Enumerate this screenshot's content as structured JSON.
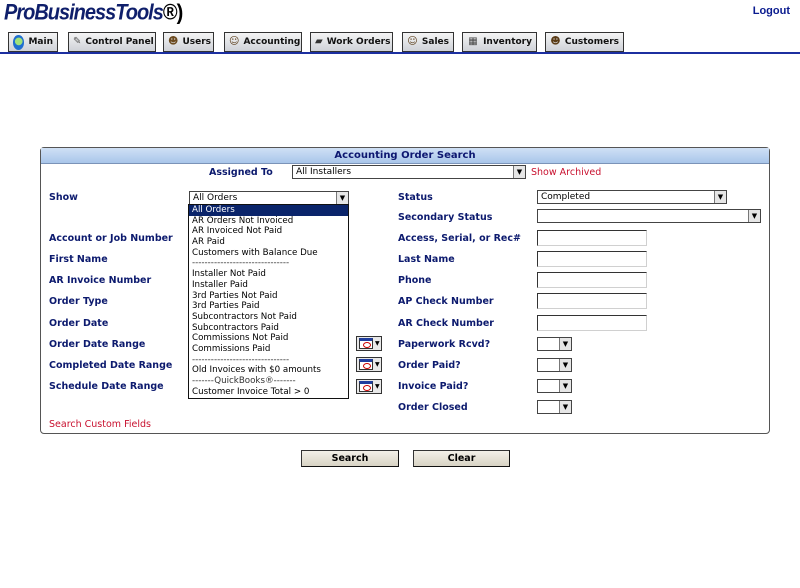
{
  "app": {
    "logo": "ProBusinessTools",
    "logo_suffix": "®)",
    "logout_label": "Logout"
  },
  "tabs": [
    {
      "label": "Main",
      "icon": "globe-icon"
    },
    {
      "label": "Control Panel",
      "icon": "tools-icon"
    },
    {
      "label": "Users",
      "icon": "users-icon"
    },
    {
      "label": "Accounting",
      "icon": "accountant-icon"
    },
    {
      "label": "Work Orders",
      "icon": "truck-icon"
    },
    {
      "label": "Sales",
      "icon": "salesperson-icon"
    },
    {
      "label": "Inventory",
      "icon": "inventory-icon"
    },
    {
      "label": "Customers",
      "icon": "customers-icon"
    }
  ],
  "panel": {
    "title": "Accounting Order Search",
    "assigned_to_label": "Assigned To",
    "assigned_to_value": "All Installers",
    "show_archived": "Show Archived",
    "left_labels": {
      "show": "Show",
      "account": "Account or Job Number",
      "first_name": "First Name",
      "ar_invoice": "AR Invoice Number",
      "order_type": "Order Type",
      "order_date": "Order Date",
      "order_date_range": "Order Date Range",
      "completed_date_range": "Completed Date Range",
      "schedule_date_range": "Schedule Date Range"
    },
    "show_value": "All Orders",
    "right_labels": {
      "status": "Status",
      "secondary_status": "Secondary Status",
      "access_serial": "Access, Serial, or Rec#",
      "last_name": "Last Name",
      "phone": "Phone",
      "ap_check": "AP Check Number",
      "ar_check": "AR Check Number",
      "paperwork": "Paperwork Rcvd?",
      "order_paid": "Order Paid?",
      "invoice_paid": "Invoice Paid?",
      "order_closed": "Order Closed"
    },
    "status_value": "Completed",
    "search_custom_fields": "Search Custom Fields"
  },
  "show_options": [
    "All Orders",
    "AR Orders Not Invoiced",
    "AR Invoiced Not Paid",
    "AR Paid",
    "Customers with Balance Due",
    "-------------------------------",
    "Installer Not Paid",
    "Installer Paid",
    "3rd Parties Not Paid",
    "3rd Parties Paid",
    "Subcontractors Not Paid",
    "Subcontractors Paid",
    "Commissions Not Paid",
    "Commissions Paid",
    "-------------------------------",
    "Old Invoices with $0 amounts",
    "-------QuickBooks®-------",
    "Customer Invoice Total > 0"
  ],
  "buttons": {
    "search": "Search",
    "clear": "Clear"
  },
  "colors": {
    "accent": "#0c1a6e",
    "tab_border": "#1c2fa0",
    "panel_header": "#a9c6ea",
    "link_red": "#c8102e"
  }
}
